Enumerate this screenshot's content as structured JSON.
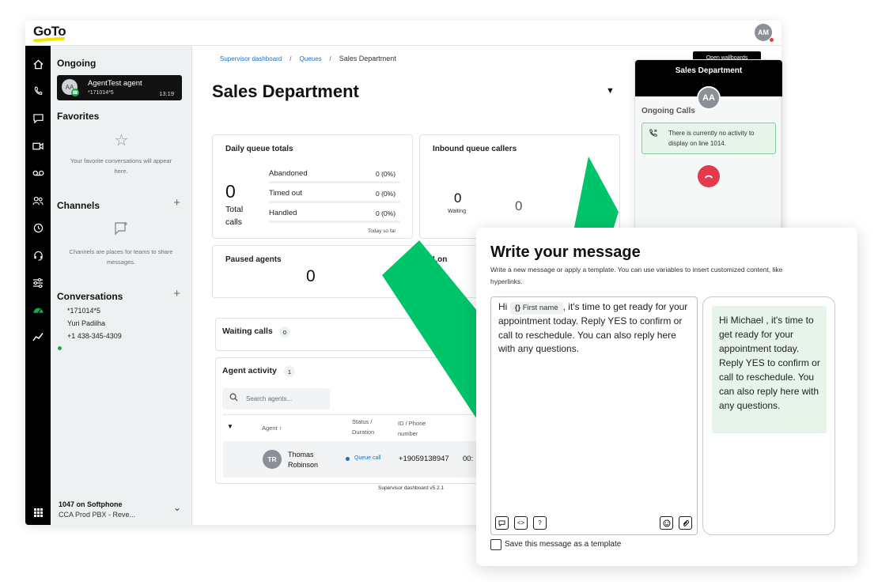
{
  "brand": {
    "logo": "GoTo",
    "logo_color": "#f2e300",
    "user_initials": "AM"
  },
  "icon_rail": [
    "home-icon",
    "phone-icon",
    "chat-icon",
    "video-icon",
    "voicemail-icon",
    "contacts-icon",
    "history-icon",
    "headset-icon",
    "sliders-icon",
    "dashboard-icon",
    "analytics-icon",
    "apps-grid-icon"
  ],
  "sidebar": {
    "ongoing": {
      "heading": "Ongoing",
      "initials": "AA",
      "name": "AgentTest agent",
      "number": "*171014*5",
      "time": "13:19"
    },
    "favorites": {
      "heading": "Favorites",
      "empty_text": "Your favorite conversations will appear here."
    },
    "channels": {
      "heading": "Channels",
      "plus": "+",
      "empty_text": "Channels are places for teams to share messages."
    },
    "conversations": {
      "heading": "Conversations",
      "plus": "+",
      "items": [
        "*171014*5",
        "Yuri Padilha",
        "+1 438-345-4309"
      ]
    },
    "softphone": {
      "title": "1047 on Softphone",
      "subtitle": "CCA Prod PBX - Reve..."
    }
  },
  "main": {
    "breadcrumb": {
      "item1": "Supervisor dashboard",
      "sep": "/",
      "item2": "Queues",
      "current": "Sales Department"
    },
    "title": "Sales Department",
    "daily": {
      "title": "Daily queue totals",
      "total_value": "0",
      "total_label": "Total calls",
      "rows": [
        {
          "label": "Abandoned",
          "value": "0 (0%)"
        },
        {
          "label": "Timed out",
          "value": "0 (0%)"
        },
        {
          "label": "Handled",
          "value": "0 (0%)"
        }
      ],
      "footnote": "Today so far"
    },
    "inbound": {
      "title": "Inbound queue callers",
      "waiting_value": "0",
      "waiting_label": "Waiting",
      "second_value": "0"
    },
    "paused": {
      "title": "Paused agents",
      "value": "0"
    },
    "longest_partial": "Lon",
    "waiting_calls": {
      "title": "Waiting calls",
      "count": "0"
    },
    "agent_activity": {
      "title": "Agent activity",
      "count": "1",
      "search_placeholder": "Search agents...",
      "columns": {
        "agent": "Agent",
        "status": "Status / Duration",
        "id": "ID / Phone number"
      },
      "row": {
        "initials": "TR",
        "name": "Thomas Robinson",
        "status": "Queue call",
        "phone": "+19059138947",
        "duration_partial": "00:"
      }
    },
    "version": "Supervisor dashboard v5.2.1"
  },
  "right_panel": {
    "button_partial": "Open wallboards",
    "title": "Sales Department",
    "initials": "AA",
    "ongoing_calls": "Ongoing Calls",
    "no_activity": "There is currently no activity to display on line 1014."
  },
  "message_modal": {
    "title": "Write your message",
    "description": "Write a new message or apply a template. You can use variables to insert customized content, like hyperlinks.",
    "editor": {
      "greeting": "Hi",
      "variable_icon": "{}",
      "variable": "First name",
      "body": ", it's time to get ready for your appointment today. Reply YES to confirm or call to reschedule. You can also reply here with any questions."
    },
    "preview": "Hi Michael  , it's time to get ready for your appointment today. Reply YES to confirm or call to reschedule. You can also reply here with any questions.",
    "save_label": "Save this message as a template"
  },
  "colors": {
    "accent_green": "#00c46a",
    "link_blue": "#1d6fbf",
    "hangup_red": "#e5394c",
    "success_bg": "#e6f4ea"
  }
}
